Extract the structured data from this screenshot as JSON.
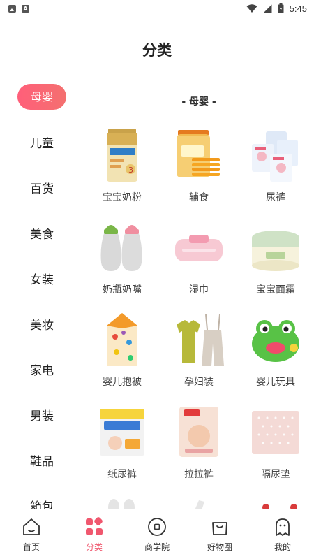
{
  "status_bar": {
    "time": "5:45",
    "left_icons": [
      "photo-icon",
      "a-icon"
    ],
    "right_icons": [
      "wifi-icon",
      "signal-icon",
      "battery-icon"
    ]
  },
  "page": {
    "title": "分类"
  },
  "accent_color": "#f0576e",
  "sidebar": {
    "items": [
      {
        "label": "母婴",
        "active": true
      },
      {
        "label": "儿童"
      },
      {
        "label": "百货"
      },
      {
        "label": "美食"
      },
      {
        "label": "女装"
      },
      {
        "label": "美妆"
      },
      {
        "label": "家电"
      },
      {
        "label": "男装"
      },
      {
        "label": "鞋品"
      },
      {
        "label": "箱包"
      }
    ]
  },
  "content": {
    "section_title": "- 母婴 -",
    "items": [
      {
        "label": "宝宝奶粉",
        "icon": "milk-powder-icon"
      },
      {
        "label": "辅食",
        "icon": "baby-snack-icon"
      },
      {
        "label": "尿裤",
        "icon": "diaper-pack-icon"
      },
      {
        "label": "奶瓶奶嘴",
        "icon": "baby-bottle-icon"
      },
      {
        "label": "湿巾",
        "icon": "wet-wipes-icon"
      },
      {
        "label": "宝宝面霜",
        "icon": "baby-cream-icon"
      },
      {
        "label": "婴儿抱被",
        "icon": "swaddle-blanket-icon"
      },
      {
        "label": "孕妇装",
        "icon": "maternity-clothes-icon"
      },
      {
        "label": "婴儿玩具",
        "icon": "baby-toy-icon"
      },
      {
        "label": "纸尿裤",
        "icon": "paper-diaper-icon"
      },
      {
        "label": "拉拉裤",
        "icon": "pull-up-pants-icon"
      },
      {
        "label": "隔尿垫",
        "icon": "changing-pad-icon"
      }
    ]
  },
  "bottom_nav": {
    "items": [
      {
        "label": "首页",
        "icon": "home-icon"
      },
      {
        "label": "分类",
        "icon": "category-icon",
        "active": true
      },
      {
        "label": "商学院",
        "icon": "school-icon"
      },
      {
        "label": "好物圈",
        "icon": "bag-icon"
      },
      {
        "label": "我的",
        "icon": "profile-icon"
      }
    ]
  }
}
